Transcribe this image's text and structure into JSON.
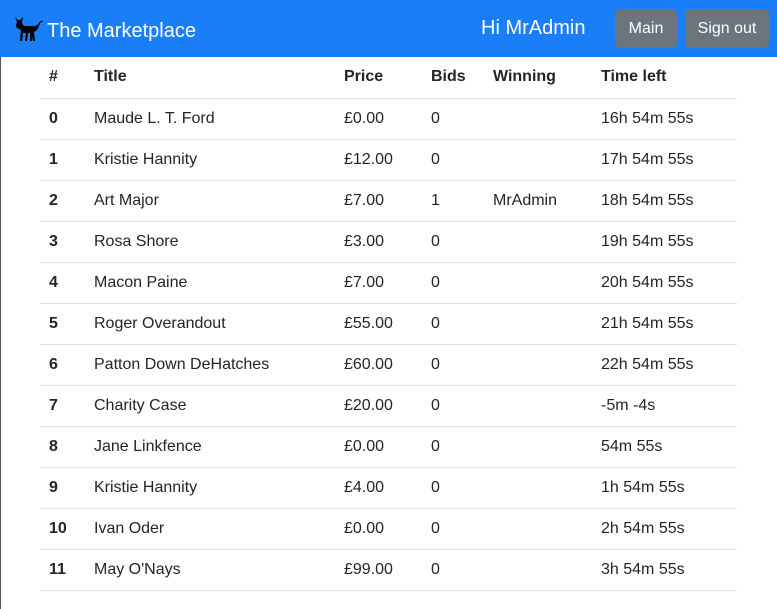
{
  "navbar": {
    "brand": "The Marketplace",
    "brand_icon": "cat-icon",
    "greeting": "Hi MrAdmin",
    "main_label": "Main",
    "signout_label": "Sign out",
    "bg_color": "#1a7ef8",
    "button_color": "#6c757d"
  },
  "table": {
    "headers": [
      "#",
      "Title",
      "Price",
      "Bids",
      "Winning",
      "Time left"
    ],
    "rows": [
      {
        "num": "0",
        "title": "Maude L. T. Ford",
        "price": "£0.00",
        "bids": "0",
        "winning": "",
        "time": "16h 54m 55s"
      },
      {
        "num": "1",
        "title": "Kristie Hannity",
        "price": "£12.00",
        "bids": "0",
        "winning": "",
        "time": "17h 54m 55s"
      },
      {
        "num": "2",
        "title": "Art Major",
        "price": "£7.00",
        "bids": "1",
        "winning": "MrAdmin",
        "time": "18h 54m 55s"
      },
      {
        "num": "3",
        "title": "Rosa Shore",
        "price": "£3.00",
        "bids": "0",
        "winning": "",
        "time": "19h 54m 55s"
      },
      {
        "num": "4",
        "title": "Macon Paine",
        "price": "£7.00",
        "bids": "0",
        "winning": "",
        "time": "20h 54m 55s"
      },
      {
        "num": "5",
        "title": "Roger Overandout",
        "price": "£55.00",
        "bids": "0",
        "winning": "",
        "time": "21h 54m 55s"
      },
      {
        "num": "6",
        "title": "Patton Down DeHatches",
        "price": "£60.00",
        "bids": "0",
        "winning": "",
        "time": "22h 54m 55s"
      },
      {
        "num": "7",
        "title": "Charity Case",
        "price": "£20.00",
        "bids": "0",
        "winning": "",
        "time": "-5m -4s"
      },
      {
        "num": "8",
        "title": "Jane Linkfence",
        "price": "£0.00",
        "bids": "0",
        "winning": "",
        "time": "54m 55s"
      },
      {
        "num": "9",
        "title": "Kristie Hannity",
        "price": "£4.00",
        "bids": "0",
        "winning": "",
        "time": "1h 54m 55s"
      },
      {
        "num": "10",
        "title": "Ivan Oder",
        "price": "£0.00",
        "bids": "0",
        "winning": "",
        "time": "2h 54m 55s"
      },
      {
        "num": "11",
        "title": "May O'Nays",
        "price": "£99.00",
        "bids": "0",
        "winning": "",
        "time": "3h 54m 55s"
      }
    ]
  }
}
